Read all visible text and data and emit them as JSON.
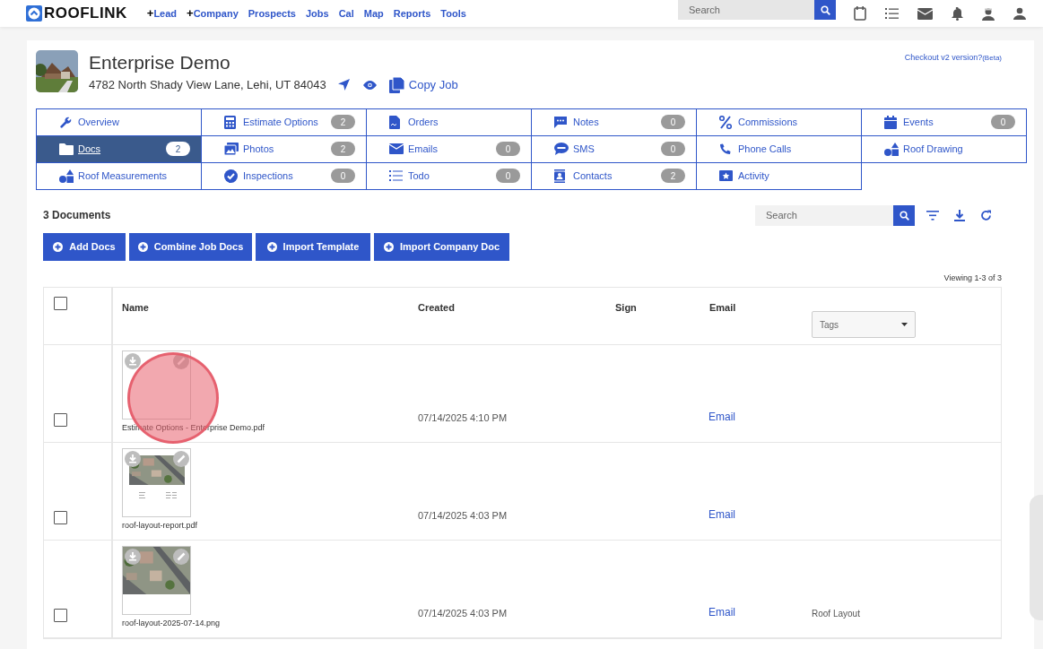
{
  "navbar": {
    "brand": "ROOFLINK",
    "links": [
      {
        "prefix": "+",
        "label": "Lead"
      },
      {
        "prefix": "+",
        "label": "Company"
      },
      {
        "label": "Prospects"
      },
      {
        "label": "Jobs"
      },
      {
        "label": "Cal"
      },
      {
        "label": "Map"
      },
      {
        "label": "Reports"
      },
      {
        "label": "Tools"
      }
    ],
    "search": {
      "placeholder": "Search"
    }
  },
  "job": {
    "title": "Enterprise Demo",
    "address": "4782 North Shady View Lane, Lehi, UT 84043",
    "copy_label": "Copy Job",
    "v2_link": "Checkout v2 version?",
    "v2_note": "(Beta)"
  },
  "tabs": [
    {
      "label": "Overview",
      "selected": false
    },
    {
      "label": "Estimate Options",
      "count": "2",
      "selected": false
    },
    {
      "label": "Orders",
      "selected": false
    },
    {
      "label": "Notes",
      "count": "0",
      "selected": false
    },
    {
      "label": "Commissions",
      "selected": false
    },
    {
      "label": "Events",
      "count": "0",
      "selected": false
    },
    {
      "label": "Docs",
      "count": "2",
      "selected": true
    },
    {
      "label": "Photos",
      "count": "2",
      "selected": false
    },
    {
      "label": "Emails",
      "count": "0",
      "selected": false
    },
    {
      "label": "SMS",
      "count": "0",
      "selected": false
    },
    {
      "label": "Phone Calls",
      "selected": false
    },
    {
      "label": "Roof Drawing",
      "selected": false
    },
    {
      "label": "Roof Measurements",
      "selected": false
    },
    {
      "label": "Inspections",
      "count": "0",
      "selected": false
    },
    {
      "label": "Todo",
      "count": "0",
      "selected": false
    },
    {
      "label": "Contacts",
      "count": "2",
      "selected": false
    },
    {
      "label": "Activity",
      "selected": false
    }
  ],
  "documents": {
    "heading": "3 Documents",
    "search": {
      "placeholder": "Search"
    },
    "buttons": [
      "Add Docs",
      "Combine Job Docs",
      "Import Template",
      "Import Company Doc"
    ],
    "viewing": "Viewing 1-3 of 3",
    "columns": [
      "Name",
      "Created",
      "Sign",
      "Email"
    ],
    "tags_filter": {
      "placeholder": "Tags"
    },
    "select_all": {
      "checked": false
    },
    "rows": [
      {
        "checked": false,
        "kind": "blank",
        "name": "Estimate Options - Enterprise Demo.pdf",
        "created": "07/14/2025 4:10 PM",
        "email": "Email"
      },
      {
        "checked": false,
        "kind": "report",
        "name": "roof-layout-report.pdf",
        "created": "07/14/2025 4:03 PM",
        "email": "Email"
      },
      {
        "checked": false,
        "name": "roof-layout-2025-07-14.png",
        "created": "07/14/2025 4:03 PM",
        "email": "Email",
        "tags": "Roof Layout"
      }
    ]
  }
}
